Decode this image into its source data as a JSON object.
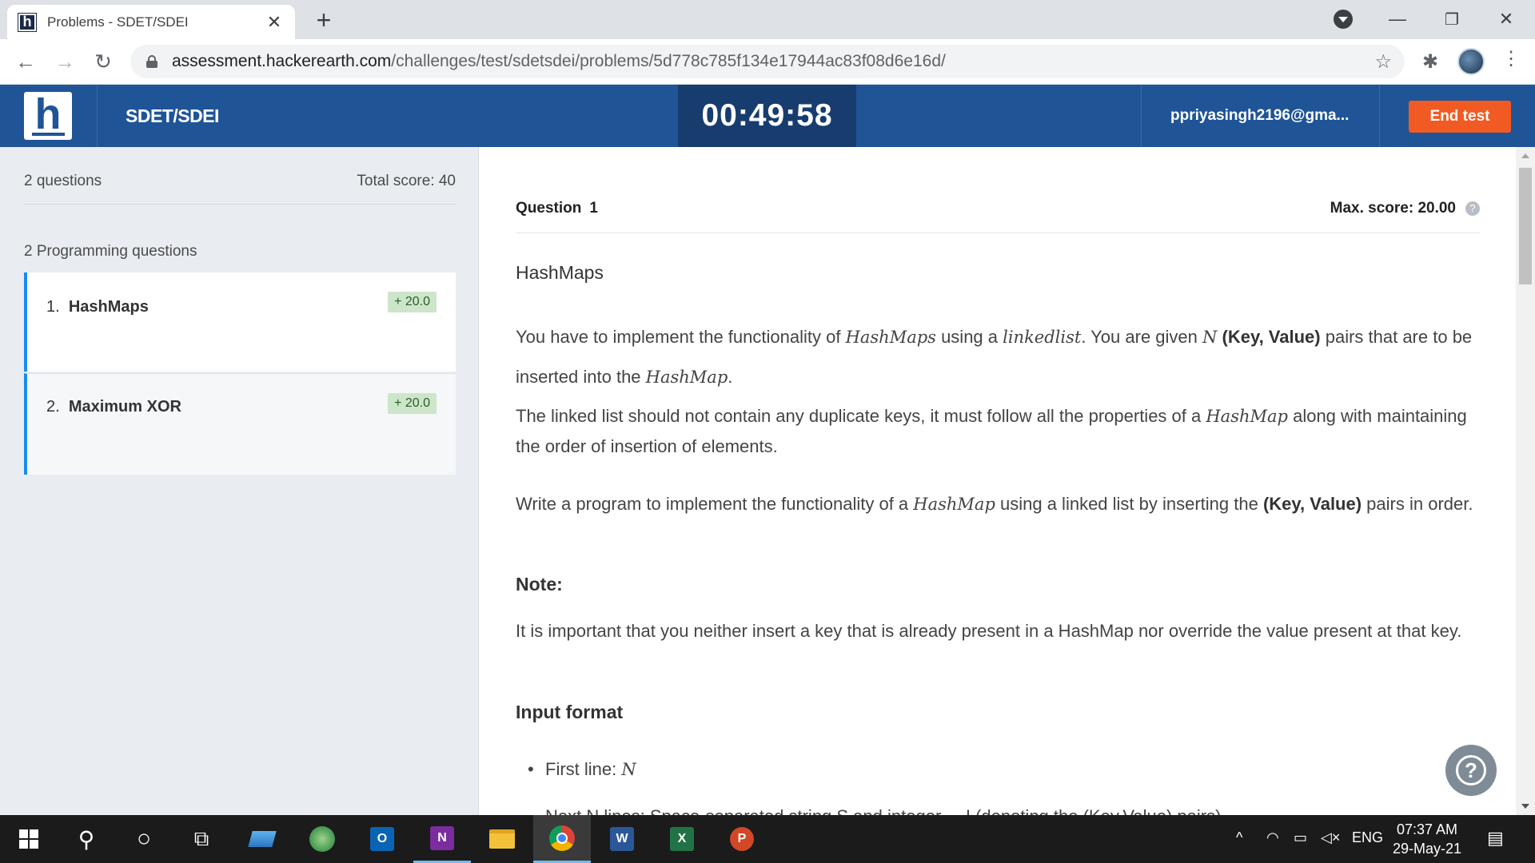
{
  "browser": {
    "tab_title": "Problems - SDET/SDEI",
    "tab_favicon_letter": "h",
    "tab_close": "✕",
    "new_tab": "+",
    "url_domain": "assessment.hackerearth.com",
    "url_path": "/challenges/test/sdetsdei/problems/5d778c785f134e17944ac83f08d6e16d/",
    "nav": {
      "back": "←",
      "forward": "→",
      "reload": "↻"
    },
    "star": "☆",
    "extension": "✱",
    "menu": "⋮",
    "window": {
      "minimize": "—",
      "maximize": "❐",
      "close": "✕"
    }
  },
  "header": {
    "logo_letter": "h",
    "test_name": "SDET/SDEI",
    "timer": "00:49:58",
    "user_email": "ppriyasingh2196@gma...",
    "end_test_label": "End test"
  },
  "sidebar": {
    "question_count": "2 questions",
    "total_score": "Total score: 40",
    "section_label": "2 Programming questions",
    "questions": [
      {
        "number": "1.",
        "title": "HashMaps",
        "score": "+ 20.0"
      },
      {
        "number": "2.",
        "title": "Maximum XOR",
        "score": "+ 20.0"
      }
    ]
  },
  "main": {
    "question_label": "Question",
    "question_number": "1",
    "max_score": "Max. score: 20.00",
    "help_mark": "?",
    "problem_title": "HashMaps",
    "p1": {
      "a": "You have to implement the functionality of ",
      "m1": "HashMaps",
      "b": " using a ",
      "m2": "linkedlist",
      "c": ". You are given ",
      "m3": "N",
      "d": " ",
      "bold1": "(Key, Value)",
      "e": " pairs that are to be inserted into the ",
      "m4": "HashMap",
      "f": "."
    },
    "p2": {
      "a": "The linked list should not contain any duplicate keys, it must follow all the properties of a ",
      "m1": "HashMap",
      "b": " along with maintaining the order of insertion of elements."
    },
    "p3": {
      "a": "Write a program to implement the functionality of a ",
      "m1": "HashMap",
      "b": " using a linked list by inserting the ",
      "bold1": "(Key, Value)",
      "c": " pairs in order."
    },
    "note_heading": "Note:",
    "note_text": "It is important that you neither insert a key that is already present in a HashMap nor override the value present at that key.",
    "input_heading": "Input format",
    "bullet1_text": "First line: ",
    "bullet1_math": "N",
    "cutoff_line": "Next N lines: Space-separated string S and integer ... I (denoting the (Key,Value) pairs)",
    "help_fab": "?"
  },
  "taskbar": {
    "search_glyph": "⚲",
    "cortana_glyph": "○",
    "taskview_glyph": "⧉",
    "apps": [
      {
        "name": "outlook",
        "letter": "O",
        "color": "#0a64b4"
      },
      {
        "name": "onenote",
        "letter": "N",
        "color": "#7b2c9e"
      },
      {
        "name": "word",
        "letter": "W",
        "color": "#2b579a"
      },
      {
        "name": "excel",
        "letter": "X",
        "color": "#217346"
      },
      {
        "name": "powerpoint",
        "letter": "P",
        "color": "#d24726"
      }
    ],
    "tray": {
      "chevron": "^",
      "wifi": "◠",
      "battery": "▭",
      "volume": "◁×",
      "language": "ENG",
      "notifications": "▤"
    },
    "time": "07:37 AM",
    "date": "29-May-21"
  }
}
